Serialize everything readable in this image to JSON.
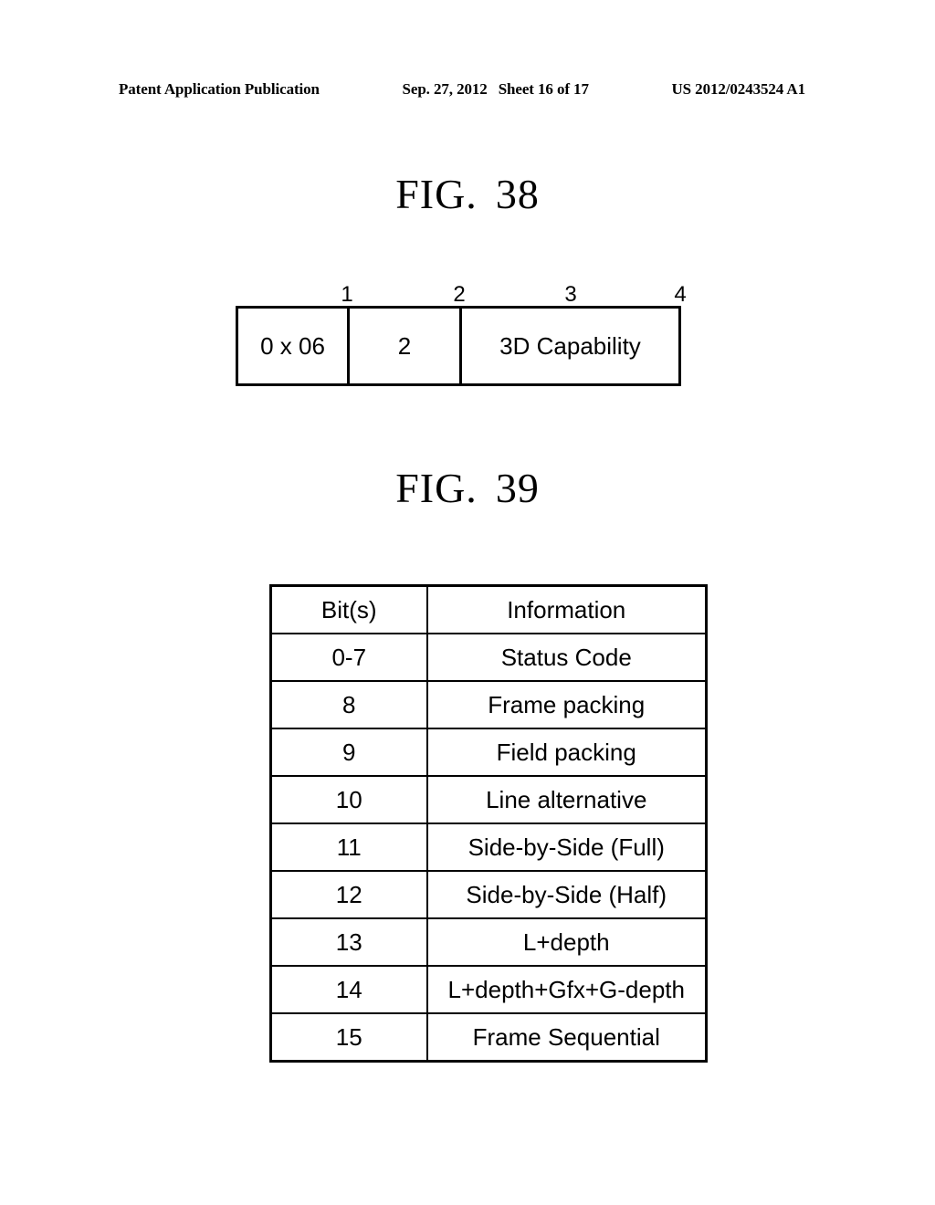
{
  "header": {
    "left": "Patent Application Publication",
    "date": "Sep. 27, 2012",
    "sheet": "Sheet 16 of 17",
    "pub_number": "US 2012/0243524 A1"
  },
  "figures": [
    {
      "id": "fig38",
      "title_word": "FIG.",
      "title_number": "38",
      "type": "byte-field-diagram",
      "ruler_labels": [
        "1",
        "2",
        "3",
        "4"
      ],
      "cells": [
        {
          "label": "0 x 06"
        },
        {
          "label": "2"
        },
        {
          "label": "3D Capability"
        }
      ]
    },
    {
      "id": "fig39",
      "title_word": "FIG.",
      "title_number": "39",
      "type": "table",
      "columns": [
        "Bit(s)",
        "Information"
      ],
      "rows": [
        {
          "bits": "0-7",
          "information": "Status Code"
        },
        {
          "bits": "8",
          "information": "Frame packing"
        },
        {
          "bits": "9",
          "information": "Field packing"
        },
        {
          "bits": "10",
          "information": "Line alternative"
        },
        {
          "bits": "11",
          "information": "Side-by-Side (Full)"
        },
        {
          "bits": "12",
          "information": "Side-by-Side (Half)"
        },
        {
          "bits": "13",
          "information": "L+depth"
        },
        {
          "bits": "14",
          "information": "L+depth+Gfx+G-depth"
        },
        {
          "bits": "15",
          "information": "Frame Sequential"
        }
      ]
    }
  ],
  "colors": {
    "ink": "#000000",
    "paper": "#ffffff"
  }
}
